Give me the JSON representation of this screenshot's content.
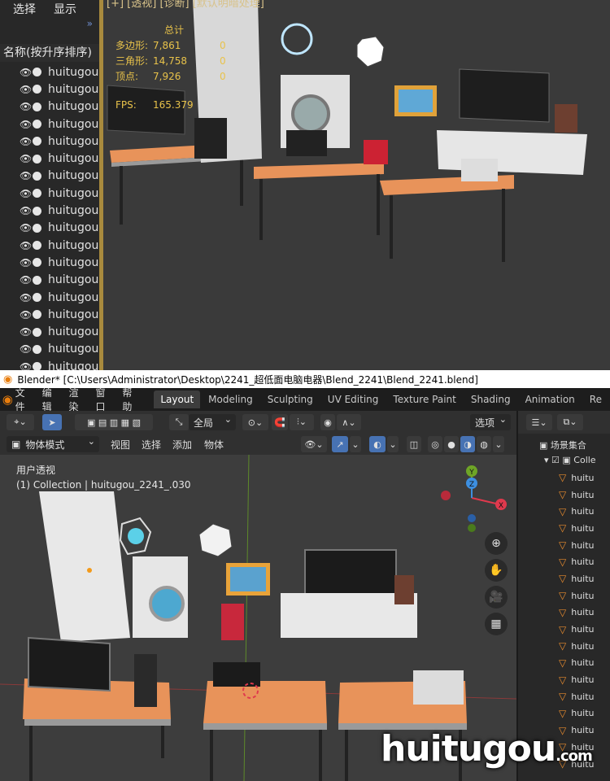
{
  "top_screenshot": {
    "outliner": {
      "header": [
        "选择",
        "显示"
      ],
      "chevron": "»",
      "sort_label": "名称(按升序排序)",
      "rows": [
        "huitugou",
        "huitugou",
        "huitugou",
        "huitugou",
        "huitugou",
        "huitugou",
        "huitugou",
        "huitugou",
        "huitugou",
        "huitugou",
        "huitugou",
        "huitugou",
        "huitugou",
        "huitugou",
        "huitugou",
        "huitugou",
        "huitugou",
        "huitugou"
      ]
    },
    "header_text": "[+]  [透视]  [诊断]  [默认明暗处理]",
    "stats": {
      "title": "总计",
      "rows": [
        {
          "label": "多边形:",
          "value": "7,861",
          "sel": "0"
        },
        {
          "label": "三角形:",
          "value": "14,758",
          "sel": "0"
        },
        {
          "label": "顶点:",
          "value": "7,926",
          "sel": "0"
        }
      ],
      "fps_label": "FPS:",
      "fps_value": "165.379"
    }
  },
  "titlebar": {
    "text": "Blender* [C:\\Users\\Administrator\\Desktop\\2241_超低面电脑电器\\Blend_2241\\Blend_2241.blend]"
  },
  "menubar": {
    "items": [
      "文件",
      "编辑",
      "渲染",
      "窗口",
      "帮助"
    ],
    "workspaces": [
      "Layout",
      "Modeling",
      "Sculpting",
      "UV Editing",
      "Texture Paint",
      "Shading",
      "Animation",
      "Re"
    ],
    "active_workspace": "Layout"
  },
  "toolbar": {
    "transform_orientation": "全局",
    "options": "选项"
  },
  "header": {
    "mode": "物体模式",
    "menus": [
      "视图",
      "选择",
      "添加",
      "物体"
    ]
  },
  "viewport": {
    "view_name": "用户透视",
    "context": "(1) Collection | huitugou_2241_.030",
    "gizmo": {
      "x": "X",
      "y": "Y",
      "z": "Z"
    }
  },
  "outliner_right": {
    "scene_collection": "场景集合",
    "collection": "Colle",
    "rows": [
      "huitu",
      "huitu",
      "huitu",
      "huitu",
      "huitu",
      "huitu",
      "huitu",
      "huitu",
      "huitu",
      "huitu",
      "huitu",
      "huitu",
      "huitu",
      "huitu",
      "huitu",
      "huitu",
      "huitu",
      "huitu"
    ]
  },
  "watermark": {
    "main": "huitugou",
    "suffix": ".com"
  },
  "colors": {
    "accent": "#4772b3",
    "blender_orange": "#e87d0d",
    "stats_text": "#e8c24a",
    "axis_x": "#e0394d",
    "axis_y": "#6ea526",
    "axis_z": "#3d8fe0"
  }
}
